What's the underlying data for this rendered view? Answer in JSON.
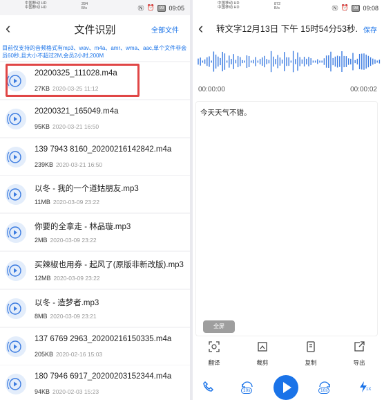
{
  "left": {
    "status": {
      "carrier": "中国移动 HD\n中国移动 HD",
      "net": "284\nB/s",
      "battery": "99",
      "time": "09:05"
    },
    "title": "文件识别",
    "action": "全部文件",
    "notice": "目前仅支持的音频格式有mp3、wav、m4a、amr、wma、aac,单个文件非会员60秒,且大小不超过2M,会员2小时,200M",
    "files": [
      {
        "name": "20200325_111028.m4a",
        "size": "27KB",
        "date": "2020-03-25 11:12"
      },
      {
        "name": "20200321_165049.m4a",
        "size": "95KB",
        "date": "2020-03-21 16:50"
      },
      {
        "name": "139 7943 8160_20200216142842.m4a",
        "size": "239KB",
        "date": "2020-03-21 16:50"
      },
      {
        "name": "以冬 - 我的一个道姑朋友.mp3",
        "size": "11MB",
        "date": "2020-03-09 23:22"
      },
      {
        "name": "你要的全拿走 - 林品璇.mp3",
        "size": "2MB",
        "date": "2020-03-09 23:22"
      },
      {
        "name": "买辣椒也用券 - 起风了(原版非新改版).mp3",
        "size": "12MB",
        "date": "2020-03-09 23:22"
      },
      {
        "name": "以冬 - 造梦者.mp3",
        "size": "8MB",
        "date": "2020-03-09 23:21"
      },
      {
        "name": "137 6769 2963_20200216150335.m4a",
        "size": "205KB",
        "date": "2020-02-16 15:03"
      },
      {
        "name": "180 7946 6917_20200203152344.m4a",
        "size": "94KB",
        "date": "2020-02-03 15:23"
      }
    ]
  },
  "right": {
    "status": {
      "carrier": "中国移动 HD\n中国移动 HD",
      "net": "872\nB/s",
      "battery": "98",
      "time": "09:08"
    },
    "title": "转文字12月13日 下午 15时54分53秒....",
    "action": "保存",
    "time_start": "00:00:00",
    "time_end": "00:00:02",
    "transcript": "今天天气不错。",
    "fullscreen": "全屏",
    "tools": [
      {
        "label": "翻译",
        "icon": "translate-icon"
      },
      {
        "label": "裁剪",
        "icon": "crop-icon"
      },
      {
        "label": "复制",
        "icon": "copy-icon"
      },
      {
        "label": "导出",
        "icon": "export-icon"
      }
    ],
    "player": {
      "rewind": "10s",
      "forward": "10s",
      "speed": "1X"
    }
  }
}
